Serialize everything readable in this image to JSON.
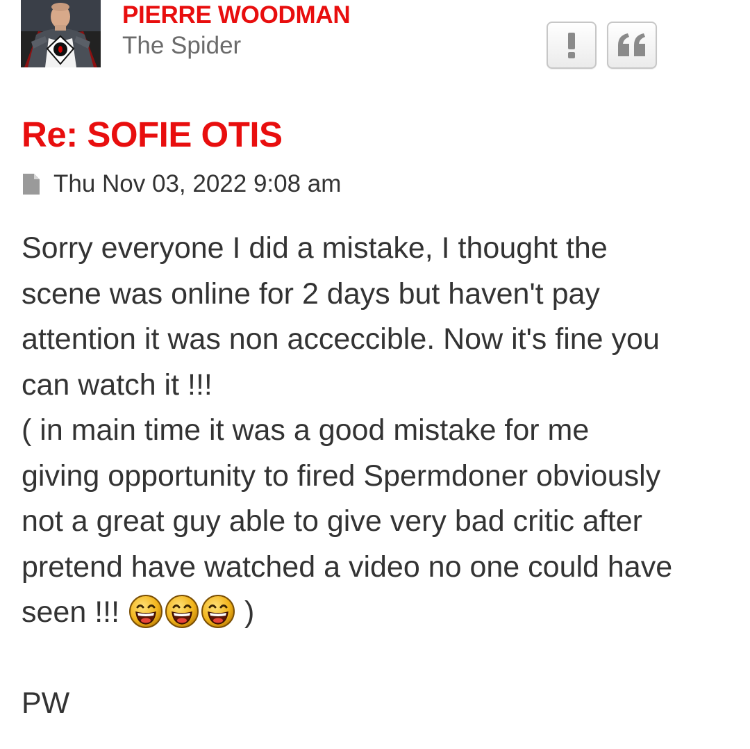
{
  "author": {
    "name": "PIERRE WOODMAN",
    "rank": "The Spider",
    "avatar_icon": "spider-superhero-avatar"
  },
  "actions": {
    "report_label": "!",
    "report_icon": "exclamation-icon",
    "quote_icon": "quote-icon"
  },
  "post": {
    "title": "Re: SOFIE OTIS",
    "date_icon": "document-icon",
    "date": "Thu Nov 03, 2022 9:08 am",
    "lines": [
      "Sorry everyone I did a mistake, I thought the",
      "scene was online for 2 days but haven't pay",
      "attention it was non acceccible. Now it's fine you",
      "can watch it !!!",
      "( in main time it was a good mistake for me",
      "giving opportunity to fired Spermdoner obviously",
      "not a great guy able to give very bad critic after",
      "pretend have watched a video no one could have"
    ],
    "last_line_prefix": "seen !!!",
    "smiley_icon": "laughing-smiley-icon",
    "smiley_count": 3,
    "last_line_suffix": ")",
    "signature": "PW"
  },
  "colors": {
    "accent": "#e80e0e",
    "text": "#333333",
    "muted": "#6b6b6b",
    "button_border": "#c7c7c7"
  }
}
